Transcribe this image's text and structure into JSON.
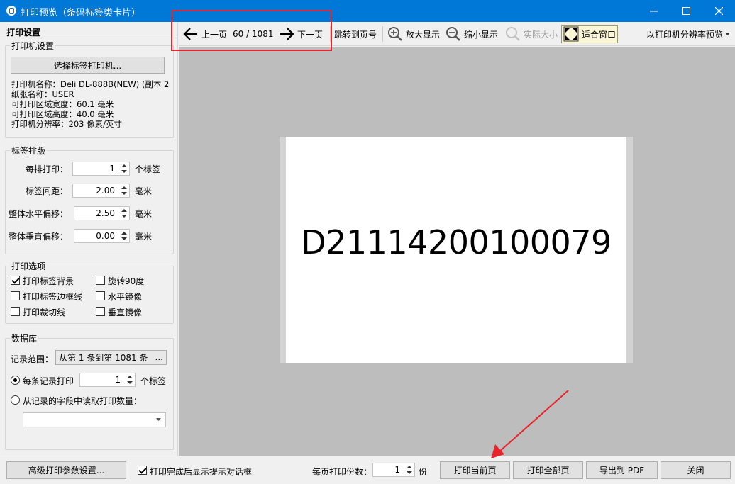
{
  "window": {
    "title": "打印预览（条码标签类卡片）",
    "controls": [
      "minimize",
      "maximize",
      "close"
    ]
  },
  "left_panel": {
    "title": "打印设置",
    "printer_group": {
      "label": "打印机设置",
      "select_button": "选择标签打印机...",
      "info": [
        "打印机名称：Deli DL-888B(NEW) (副本 2",
        "纸张名称：USER",
        "可打印区域宽度：60.1 毫米",
        "可打印区域高度：40.0 毫米",
        "打印机分辨率：203 像素/英寸"
      ]
    },
    "layout_group": {
      "label": "标签排版",
      "rows": [
        {
          "label": "每排打印：",
          "value": "1",
          "unit": "个标签"
        },
        {
          "label": "标签间距：",
          "value": "2.00",
          "unit": "毫米"
        },
        {
          "label": "整体水平偏移：",
          "value": "2.50",
          "unit": "毫米"
        },
        {
          "label": "整体垂直偏移：",
          "value": "0.00",
          "unit": "毫米"
        }
      ]
    },
    "options_group": {
      "label": "打印选项",
      "items": [
        {
          "label": "打印标签背景",
          "checked": true
        },
        {
          "label": "旋转90度",
          "checked": false
        },
        {
          "label": "打印标签边框线",
          "checked": false
        },
        {
          "label": "水平镜像",
          "checked": false
        },
        {
          "label": "打印裁切线",
          "checked": false
        },
        {
          "label": "垂直镜像",
          "checked": false
        }
      ]
    },
    "database_group": {
      "label": "数据库",
      "range_label": "记录范围：",
      "range_value": "从第 1 条到第 1081 条",
      "range_button": "...",
      "per_record_label": "每条记录打印",
      "per_record_value": "1",
      "per_record_unit": "个标签",
      "per_record_selected": true,
      "from_field_label": "从记录的字段中读取打印数量：",
      "from_field_selected": false,
      "field_dropdown_value": ""
    }
  },
  "toolbar": {
    "prev_label": "上一页",
    "page_indicator": "60 / 1081",
    "next_label": "下一页",
    "goto_label": "跳转到页号",
    "zoom_in_label": "放大显示",
    "zoom_out_label": "缩小显示",
    "actual_size_label": "实际大小",
    "fit_window_label": "适合窗口",
    "resolution_label": "以打印机分辨率预览"
  },
  "preview": {
    "label_text": "D21114200100079"
  },
  "bottom_bar": {
    "advanced_button": "高级打印参数设置...",
    "show_dialog_label": "打印完成后显示提示对话框",
    "show_dialog_checked": true,
    "copies_label": "每页打印份数：",
    "copies_value": "1",
    "copies_unit": "份",
    "print_current_button": "打印当前页",
    "print_all_button": "打印全部页",
    "export_pdf_button": "导出到 PDF",
    "close_button": "关闭"
  },
  "colors": {
    "titlebar": "#0078d7",
    "annotation_red": "#e8242c",
    "preview_background": "#bdbdbd"
  }
}
